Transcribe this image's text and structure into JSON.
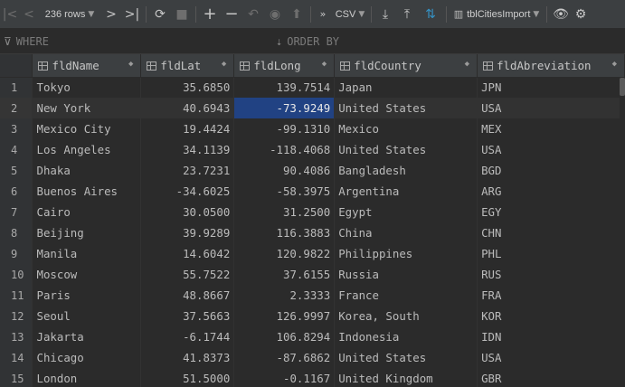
{
  "toolbar": {
    "rows_label": "236 rows",
    "export_format": "CSV",
    "table_name": "tblCitiesImport"
  },
  "filter": {
    "where_label": "WHERE",
    "order_label": "ORDER BY"
  },
  "columns": [
    "fldName",
    "fldLat",
    "fldLong",
    "fldCountry",
    "fldAbreviation"
  ],
  "rows": [
    {
      "n": "1",
      "name": "Tokyo",
      "lat": "35.6850",
      "long": "139.7514",
      "country": "Japan",
      "abbr": "JPN"
    },
    {
      "n": "2",
      "name": "New York",
      "lat": "40.6943",
      "long": "-73.9249",
      "country": "United States",
      "abbr": "USA"
    },
    {
      "n": "3",
      "name": "Mexico City",
      "lat": "19.4424",
      "long": "-99.1310",
      "country": "Mexico",
      "abbr": "MEX"
    },
    {
      "n": "4",
      "name": "Los Angeles",
      "lat": "34.1139",
      "long": "-118.4068",
      "country": "United States",
      "abbr": "USA"
    },
    {
      "n": "5",
      "name": "Dhaka",
      "lat": "23.7231",
      "long": "90.4086",
      "country": "Bangladesh",
      "abbr": "BGD"
    },
    {
      "n": "6",
      "name": "Buenos Aires",
      "lat": "-34.6025",
      "long": "-58.3975",
      "country": "Argentina",
      "abbr": "ARG"
    },
    {
      "n": "7",
      "name": "Cairo",
      "lat": "30.0500",
      "long": "31.2500",
      "country": "Egypt",
      "abbr": "EGY"
    },
    {
      "n": "8",
      "name": "Beijing",
      "lat": "39.9289",
      "long": "116.3883",
      "country": "China",
      "abbr": "CHN"
    },
    {
      "n": "9",
      "name": "Manila",
      "lat": "14.6042",
      "long": "120.9822",
      "country": "Philippines",
      "abbr": "PHL"
    },
    {
      "n": "10",
      "name": "Moscow",
      "lat": "55.7522",
      "long": "37.6155",
      "country": "Russia",
      "abbr": "RUS"
    },
    {
      "n": "11",
      "name": "Paris",
      "lat": "48.8667",
      "long": "2.3333",
      "country": "France",
      "abbr": "FRA"
    },
    {
      "n": "12",
      "name": "Seoul",
      "lat": "37.5663",
      "long": "126.9997",
      "country": "Korea, South",
      "abbr": "KOR"
    },
    {
      "n": "13",
      "name": "Jakarta",
      "lat": "-6.1744",
      "long": "106.8294",
      "country": "Indonesia",
      "abbr": "IDN"
    },
    {
      "n": "14",
      "name": "Chicago",
      "lat": "41.8373",
      "long": "-87.6862",
      "country": "United States",
      "abbr": "USA"
    },
    {
      "n": "15",
      "name": "London",
      "lat": "51.5000",
      "long": "-0.1167",
      "country": "United Kingdom",
      "abbr": "GBR"
    }
  ],
  "selection": {
    "row": "2",
    "column": "fldLong"
  },
  "colors": {
    "background": "#2b2b2b",
    "toolbar": "#3c3f41",
    "selection": "#214283",
    "accent": "#3592c4"
  }
}
